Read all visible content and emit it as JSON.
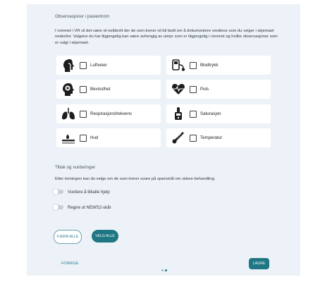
{
  "observations": {
    "title": "Observasjoner i pasientrom",
    "intro": "I rommet i VR vil det være et nettbrett der de som trener vil bli bedt om å dokumentere verdiene som du velger i skjemaet nedenfor. Valgene du har tilgjengelig kan være avhengig av utstyr som er tilgjengelig i rommet og hvilke observasjoner som er valgt i skjemaet.",
    "items": [
      {
        "label": "Luftveier",
        "icon": "airway-icon",
        "checked": false
      },
      {
        "label": "Blodtrykk",
        "icon": "blood-pressure-icon",
        "checked": false
      },
      {
        "label": "Bevissthet",
        "icon": "consciousness-head-icon",
        "checked": false
      },
      {
        "label": "Puls",
        "icon": "heart-pulse-icon",
        "checked": false
      },
      {
        "label": "Respirasjonsfrekvens",
        "icon": "lungs-icon",
        "checked": false
      },
      {
        "label": "Saturasjon",
        "icon": "pulse-oximeter-icon",
        "checked": false
      },
      {
        "label": "Hud",
        "icon": "skin-icon",
        "checked": false
      },
      {
        "label": "Temperatur",
        "icon": "thermometer-icon",
        "checked": false
      }
    ]
  },
  "actions": {
    "title": "Tiltak og vurderinger",
    "intro": "Etter treningen kan du velge om de som trener svare på spørsmål om videre behandling.",
    "toggles": [
      {
        "label": "Vurdere å tilkalle hjelp",
        "on": false
      },
      {
        "label": "Regne ut NEWS2-skår",
        "on": false
      }
    ]
  },
  "buttons": {
    "remove_all": "FJERN ALLE",
    "select_all": "VELG ALLE",
    "previous": "FORRIGE",
    "save": "LAGRE"
  },
  "pagination": {
    "current": 2,
    "total": 2
  },
  "colors": {
    "primary": "#1f7784",
    "panel": "#edf2f8",
    "card": "#ffffff",
    "dot_active": "#1f7784",
    "dot_inactive": "#9ab9c0"
  }
}
